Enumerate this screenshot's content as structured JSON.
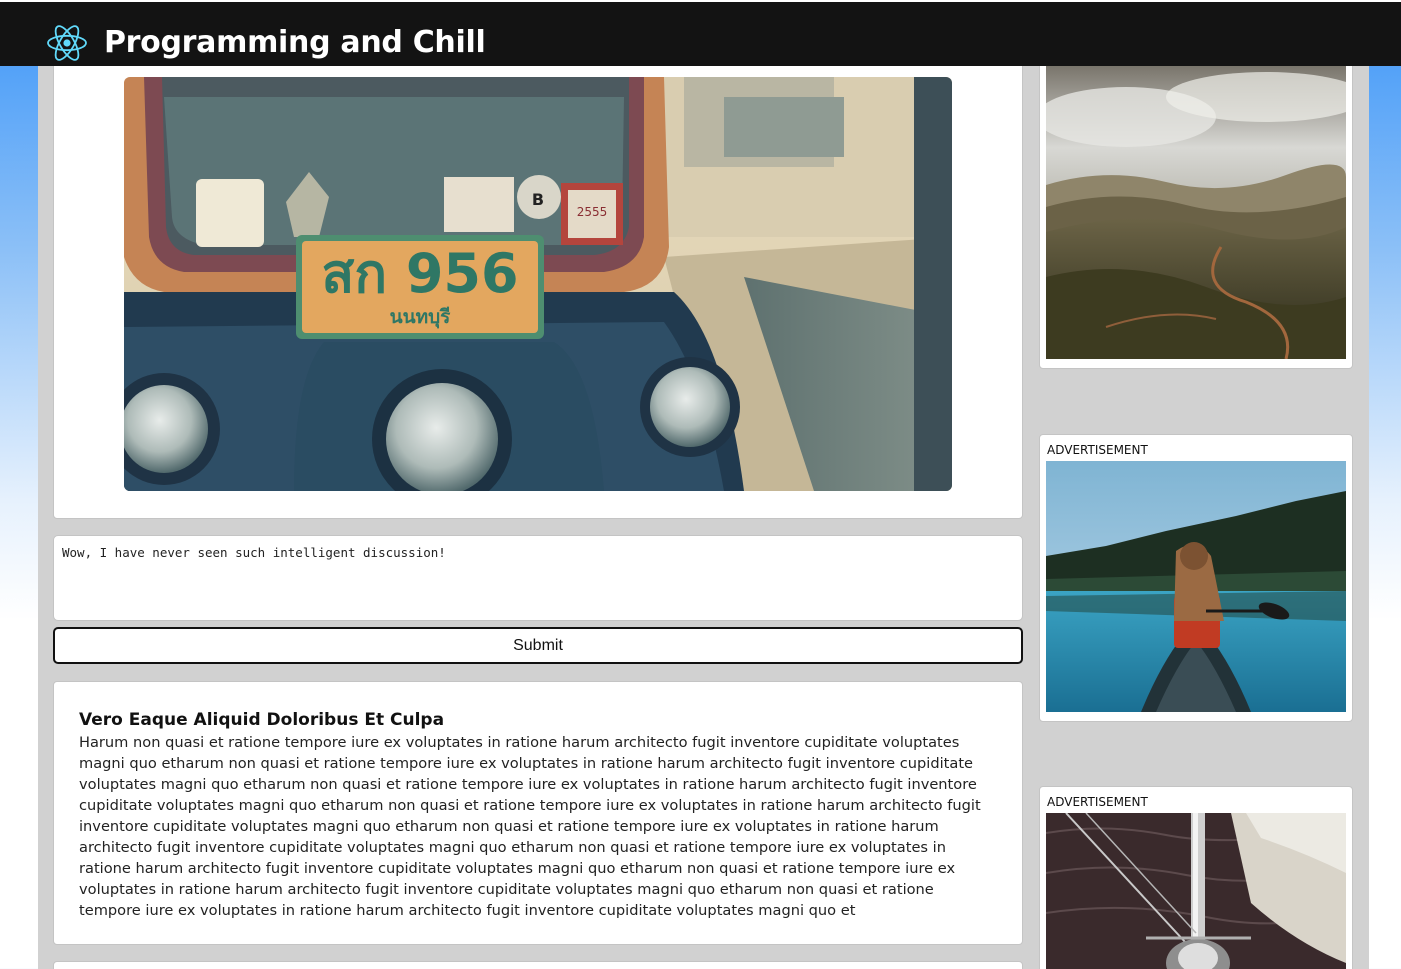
{
  "header": {
    "logo_icon": "react-atom-icon",
    "title": "Programming and Chill",
    "background": "#131313",
    "logo_color": "#61dafb"
  },
  "post_image": {
    "icon": "tuk-tuk-photo",
    "plate_text": "สก 956",
    "plate_subtext": "นนทบุรี",
    "sticker_text": "2555",
    "sticker_letter": "B"
  },
  "comment": {
    "value": "Wow, I have never seen such intelligent discussion!"
  },
  "submit": {
    "label": "Submit"
  },
  "post": {
    "title": "Vero Eaque Aliquid Doloribus Et Culpa",
    "body": "Harum non quasi et ratione tempore iure ex voluptates in ratione harum architecto fugit inventore cupiditate voluptates magni quo etharum non quasi et ratione tempore iure ex voluptates in ratione harum architecto fugit inventore cupiditate voluptates magni quo etharum non quasi et ratione tempore iure ex voluptates in ratione harum architecto fugit inventore cupiditate voluptates magni quo etharum non quasi et ratione tempore iure ex voluptates in ratione harum architecto fugit inventore cupiditate voluptates magni quo etharum non quasi et ratione tempore iure ex voluptates in ratione harum architecto fugit inventore cupiditate voluptates magni quo etharum non quasi et ratione tempore iure ex voluptates in ratione harum architecto fugit inventore cupiditate voluptates magni quo etharum non quasi et ratione tempore iure ex voluptates in ratione harum architecto fugit inventore cupiditate voluptates magni quo etharum non quasi et ratione tempore iure ex voluptates in ratione harum architecto fugit inventore cupiditate voluptates magni quo et"
  },
  "ads": [
    {
      "label": "",
      "icon": "mountain-landscape-photo"
    },
    {
      "label": "ADVERTISEMENT",
      "icon": "canoe-lake-photo"
    },
    {
      "label": "ADVERTISEMENT",
      "icon": "sailboat-mast-photo"
    }
  ]
}
